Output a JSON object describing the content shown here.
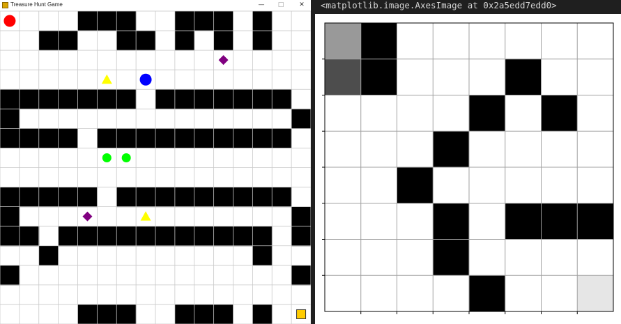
{
  "window": {
    "title": "Treasure Hunt Game",
    "minimize_glyph": "—",
    "maximize_glyph": "□",
    "close_glyph": "✕",
    "icon": "treasure-chest-icon"
  },
  "game": {
    "cols": 16,
    "rows": 16,
    "wall_color": "#000000",
    "floor_color": "#ffffff",
    "walls": [
      "....###..###.#..",
      "..##..##.#.#.#..",
      "................",
      "................",
      "#######.#######.",
      "#..............#",
      "####.##########.",
      "................",
      "................",
      "#####.#########.",
      "#..............#",
      "##.###########.#",
      "..#..........#..",
      "#..............#",
      "................",
      "....###..###.#.."
    ],
    "items": [
      {
        "type": "red-circle-player",
        "shape": "circle",
        "color": "#ff0000",
        "row": 0,
        "col": 0
      },
      {
        "type": "purple-diamond",
        "shape": "diamond",
        "color": "#800080",
        "row": 2,
        "col": 11
      },
      {
        "type": "yellow-triangle",
        "shape": "triangle",
        "color": "#ffff00",
        "row": 3,
        "col": 5
      },
      {
        "type": "blue-circle-player",
        "shape": "circle",
        "color": "#0000ff",
        "row": 3,
        "col": 7
      },
      {
        "type": "green-dot",
        "shape": "dot",
        "color": "#00ff00",
        "row": 7,
        "col": 5
      },
      {
        "type": "green-dot",
        "shape": "dot",
        "color": "#00ff00",
        "row": 7,
        "col": 6
      },
      {
        "type": "purple-diamond",
        "shape": "diamond",
        "color": "#800080",
        "row": 10,
        "col": 4
      },
      {
        "type": "yellow-triangle",
        "shape": "triangle",
        "color": "#ffff00",
        "row": 10,
        "col": 7
      },
      {
        "type": "gold-square-treasure",
        "shape": "square",
        "color": "#ffcc00",
        "row": 15,
        "col": 15
      }
    ]
  },
  "notebook": {
    "output_text": "<matplotlib.image.AxesImage at 0x2a5edd7edd0>"
  },
  "plot": {
    "grid": [
      [
        0.6,
        0,
        1,
        1,
        1,
        1,
        1,
        1
      ],
      [
        0.3,
        0,
        1,
        1,
        1,
        0,
        1,
        1
      ],
      [
        1,
        1,
        1,
        1,
        0,
        1,
        0,
        1
      ],
      [
        1,
        1,
        1,
        0,
        1,
        1,
        1,
        1
      ],
      [
        1,
        1,
        0,
        1,
        1,
        1,
        1,
        1
      ],
      [
        1,
        1,
        1,
        0,
        1,
        0,
        0,
        0
      ],
      [
        1,
        1,
        1,
        0,
        1,
        1,
        1,
        1
      ],
      [
        1,
        1,
        1,
        1,
        0,
        1,
        1,
        0.9
      ]
    ],
    "colormap": "gray",
    "gridline_color": "#a0a0a0",
    "show_tick_labels": false
  }
}
